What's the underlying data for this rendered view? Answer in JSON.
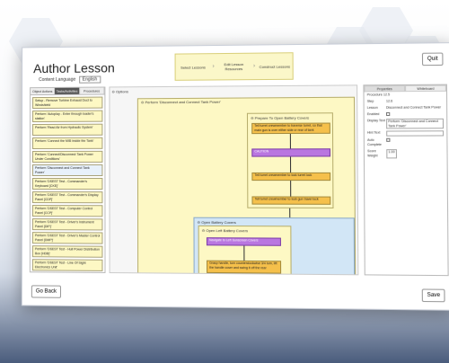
{
  "header": {
    "title": "Author Lesson",
    "content_language_label": "Content Language",
    "content_language_value": "English",
    "quit_label": "Quit"
  },
  "wizard_steps": [
    "Select Lessons",
    "Edit Lesson Resources",
    "Construct Lessons"
  ],
  "left_panel": {
    "tabs": [
      "Object Actions",
      "Tasks/Activities",
      "Procedures"
    ],
    "cards": [
      "Setup - Remove Turbine Exhaust Duct to Windshield",
      "Perform 'Autoplay - Enter through loader's station'",
      "Perform 'Read Air from Hydraulic System'",
      "Perform 'Connect the MIB inside the Tank'",
      "Perform 'Connect/Disconnect Tank Power Under Conditions'",
      "Perform 'Disconnect and Connect Tank Power'",
      "Perform 'DSEST Test - Commander's Keyboard [CKE]'",
      "Perform 'DSEST Test - Commander's Display Panel [CDP]'",
      "Perform 'DSEST Test - Computer Control Panel [CCP]'",
      "Perform 'DSEST Test - Driver's Instrument Panel [DIP]'",
      "Perform 'DSEST Test - Driver's Master Control Panel [DMP]'",
      "Perform 'DSEST Test - Hull Power Distribution Box [HDB]'",
      "Perform 'DSEST Test - Line Of Sight Electronics Unit'"
    ]
  },
  "canvas": {
    "options_label": "Options",
    "outer_label": "Perform 'Disconnect and Connect Tank Power'",
    "prep_label": "Prepare To Open Battery Covers",
    "prep_nodes": [
      "Tell turret crewmember to traverse turret, so that main gun is over either side or rear of tank",
      "CAUTION",
      "Tell turret crewmember to lock turret lock",
      "Tell turret crewmember to lock gun travel lock"
    ],
    "open_label": "Open Battery Covers",
    "openleft_label": "Open Left Battery Covers",
    "openleft_nodes": [
      "Navigate to Left Sunscreen Covers",
      "Grasp handle, turn counterclockwise 3/4 turn, lift the handle cover and swing it off the rear"
    ]
  },
  "right_panel": {
    "tabs": [
      "Properties",
      "Whiteboard"
    ],
    "procedure": "Procedure  12.5",
    "step_label": "Step",
    "step_value": "12.6",
    "lesson_label": "Lesson",
    "lesson_value": "Disconnect and Connect Tank Power",
    "enabled_label": "Enabled",
    "display_text_label": "Display Text",
    "display_text_value": "Perform 'Disconnect and Connect Tank Power'",
    "hint_text_label": "Hint Text",
    "auto_complete_label": "Auto Complete",
    "score_weight_label": "Score Weight",
    "score_weight_value": "1.00"
  },
  "footer": {
    "back_label": "Go Back",
    "save_label": "Save"
  }
}
